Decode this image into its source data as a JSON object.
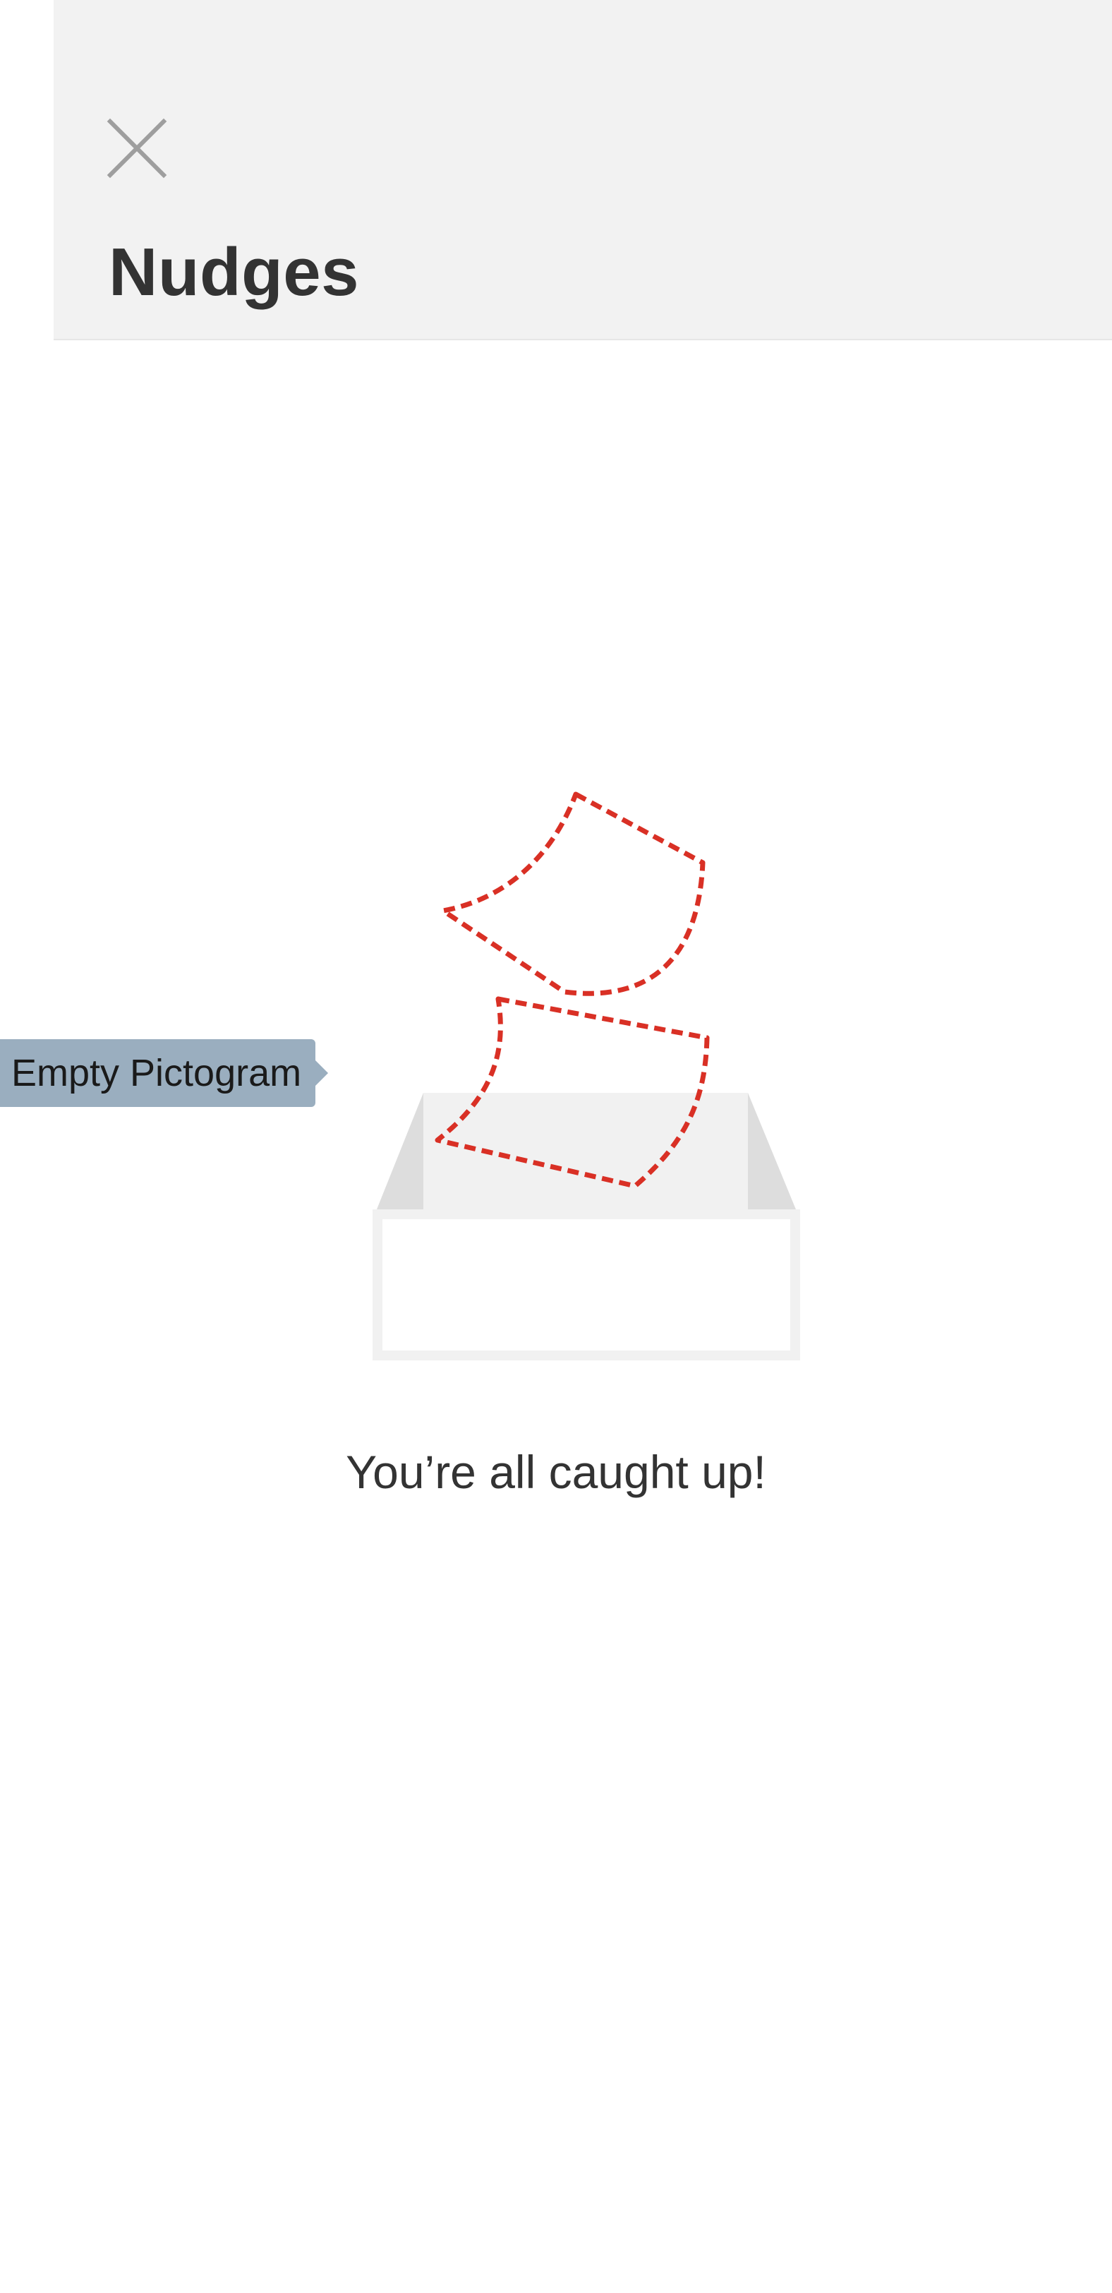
{
  "header": {
    "title": "Nudges",
    "close_icon": "close-icon"
  },
  "annotation": {
    "tag_label": "Empty Pictogram"
  },
  "empty_state": {
    "message": "You’re all caught up!",
    "pictogram_icon": "empty-inbox-pictogram"
  },
  "colors": {
    "header_background": "#f2f2f2",
    "title_text": "#333333",
    "close_icon": "#9e9e9e",
    "tag_background": "#9aaebf",
    "paper_outline": "#d93025",
    "box_light": "#f1f1f1",
    "box_side": "#dddddd"
  }
}
